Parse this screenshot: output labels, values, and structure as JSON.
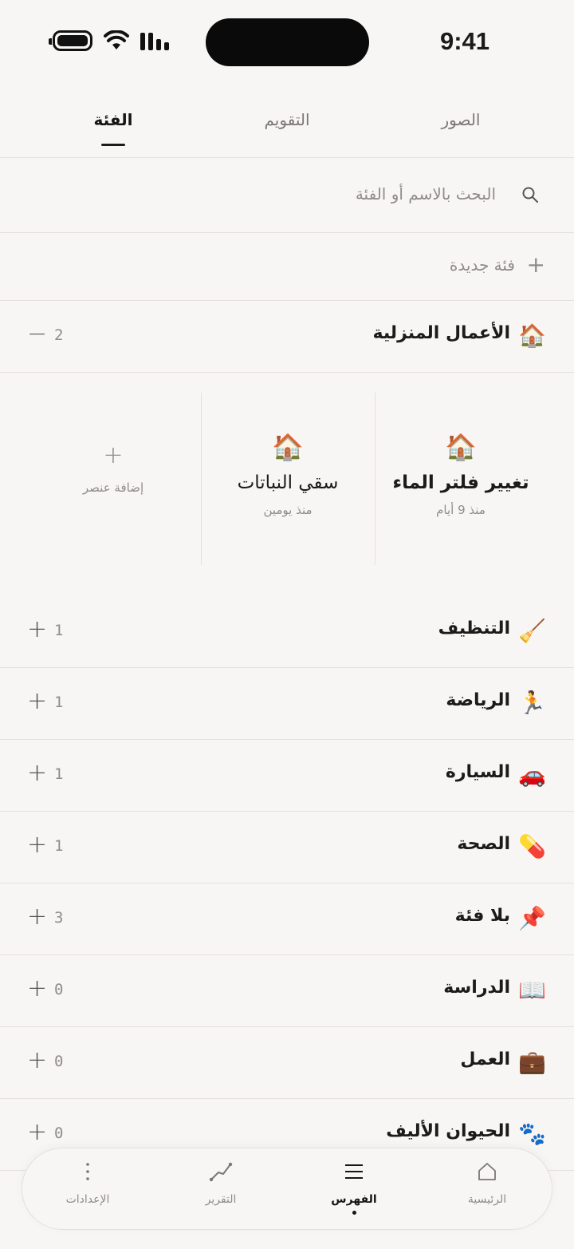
{
  "status_bar": {
    "time": "9:41"
  },
  "tabs": [
    {
      "label": "الصور"
    },
    {
      "label": "التقويم"
    },
    {
      "label": "الفئة"
    }
  ],
  "search": {
    "placeholder": "البحث بالاسم أو الفئة"
  },
  "new_category": {
    "label": "فئة جديدة"
  },
  "expanded_category": {
    "emoji": "🏠",
    "name": "الأعمال المنزلية",
    "count": "2",
    "items": [
      {
        "emoji": "🏠",
        "title": "تغيير فلتر الماء",
        "subtitle": "منذ 9 أيام"
      },
      {
        "emoji": "🏠",
        "title": "سقي النباتات",
        "subtitle": "منذ يومين"
      }
    ],
    "add_item_label": "إضافة عنصر"
  },
  "categories": [
    {
      "emoji": "🧹",
      "name": "التنظيف",
      "count": "1"
    },
    {
      "emoji": "🏃",
      "name": "الرياضة",
      "count": "1"
    },
    {
      "emoji": "🚗",
      "name": "السيارة",
      "count": "1"
    },
    {
      "emoji": "💊",
      "name": "الصحة",
      "count": "1"
    },
    {
      "emoji": "📌",
      "name": "بلا فئة",
      "count": "3"
    },
    {
      "emoji": "📖",
      "name": "الدراسة",
      "count": "0"
    },
    {
      "emoji": "💼",
      "name": "العمل",
      "count": "0"
    },
    {
      "emoji": "🐾",
      "name": "الحيوان الأليف",
      "count": "0"
    }
  ],
  "bottom_nav": [
    {
      "label": "الرئيسية",
      "icon": "home-icon"
    },
    {
      "label": "الفهرس",
      "icon": "menu-icon"
    },
    {
      "label": "التقرير",
      "icon": "chart-line-icon"
    },
    {
      "label": "الإعدادات",
      "icon": "more-vertical-icon"
    }
  ]
}
